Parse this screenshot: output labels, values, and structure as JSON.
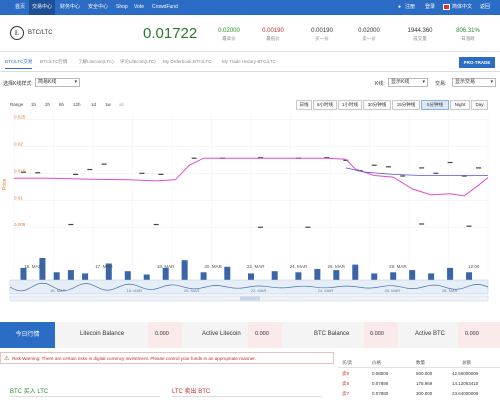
{
  "nav": {
    "items": [
      "首页",
      "交易中心",
      "财务中心",
      "安全中心",
      "Shop",
      "Vote",
      "CrowdFund"
    ],
    "active_index": 1,
    "right": [
      "注册",
      "登录",
      "简体中文",
      "返回"
    ]
  },
  "ticker": {
    "pair": "BTC/LTC",
    "last_price": "0.01722",
    "stats": [
      {
        "value": "0.02000",
        "label": "最高价",
        "color": "#2a8a2a"
      },
      {
        "value": "0.00190",
        "label": "最低价",
        "color": "#c0302a"
      },
      {
        "value": "0.00190",
        "label": "买一价",
        "color": "#333333"
      },
      {
        "value": "0.02000",
        "label": "卖一价",
        "color": "#333333"
      },
      {
        "value": "1944.360",
        "label": "成交量",
        "color": "#333333"
      },
      {
        "value": "806.31%",
        "label": "日涨跌",
        "color": "#2a8a2a"
      }
    ]
  },
  "tabs": {
    "items": [
      "BTC/LTC交易",
      "BTC/LTC行情",
      "了解Litecoin(LTC)",
      "评论Litecoin(LTC)",
      "My Orderbook-BTC/LTC",
      "My Trade History-BTC/LTC"
    ],
    "active_index": 0,
    "pro_button": "PRO-TRADE"
  },
  "toolbar": {
    "mode_label": "选择K线样式:",
    "mode_value": "简易K线",
    "kline_label": "K线:",
    "kline_value": "显示K线",
    "trades_label": "交易:",
    "trades_value": "显示交易"
  },
  "range": {
    "label": "Range",
    "buttons": [
      "1h",
      "2h",
      "6h",
      "12h",
      "1d",
      "1w",
      "all"
    ],
    "periods": [
      "日线",
      "6小时线",
      "1小时线",
      "30分钟线",
      "15分钟线",
      "5分钟线",
      "Night",
      "Day"
    ],
    "active_period_index": 5
  },
  "chart_data": {
    "type": "line",
    "y_axis_label": "Price",
    "y_ticks": [
      "0.025",
      "0.02",
      "0.015",
      "0.01",
      "0.005"
    ],
    "ylim": [
      0.003,
      0.026
    ],
    "x_labels": [
      "16. MAR",
      "17. MAR",
      "18. MAR",
      "20. MAR",
      "22. MAR",
      "24. MAR",
      "26. MAR",
      "28. MAR",
      "12:00"
    ],
    "navigator_labels": [
      "16. MAR",
      "18. MAR",
      "20. MAR",
      "22. MAR",
      "24. MAR",
      "26. MAR",
      "28. MAR"
    ],
    "ma_series": [
      [
        0,
        0.0141
      ],
      [
        0.08,
        0.0141
      ],
      [
        0.16,
        0.0139
      ],
      [
        0.24,
        0.0138
      ],
      [
        0.3,
        0.0136
      ],
      [
        0.34,
        0.0138
      ],
      [
        0.37,
        0.0165
      ],
      [
        0.4,
        0.0178
      ],
      [
        0.5,
        0.0178
      ],
      [
        0.6,
        0.0178
      ],
      [
        0.66,
        0.0178
      ],
      [
        0.7,
        0.0176
      ],
      [
        0.72,
        0.0158
      ],
      [
        0.76,
        0.0146
      ],
      [
        0.8,
        0.0143
      ],
      [
        0.84,
        0.0121
      ],
      [
        0.88,
        0.011
      ],
      [
        0.92,
        0.0112
      ],
      [
        0.95,
        0.0108
      ],
      [
        0.98,
        0.0128
      ],
      [
        1.0,
        0.0142
      ]
    ],
    "avg_series": [
      [
        0.7,
        0.016
      ],
      [
        0.74,
        0.0152
      ],
      [
        0.8,
        0.0148
      ],
      [
        0.86,
        0.0146
      ],
      [
        0.92,
        0.0146
      ],
      [
        1.0,
        0.0146
      ]
    ],
    "candles": [
      [
        0.02,
        0.0152
      ],
      [
        0.05,
        0.0151
      ],
      [
        0.13,
        0.0148
      ],
      [
        0.16,
        0.0157
      ],
      [
        0.19,
        0.0167
      ],
      [
        0.27,
        0.015
      ],
      [
        0.31,
        0.0148
      ],
      [
        0.38,
        0.0178
      ],
      [
        0.44,
        0.0178
      ],
      [
        0.52,
        0.0179
      ],
      [
        0.6,
        0.0178
      ],
      [
        0.66,
        0.0179
      ],
      [
        0.7,
        0.0174
      ],
      [
        0.73,
        0.0155
      ],
      [
        0.76,
        0.0165
      ],
      [
        0.79,
        0.0162
      ],
      [
        0.82,
        0.0145
      ],
      [
        0.86,
        0.016
      ],
      [
        0.89,
        0.015
      ],
      [
        0.92,
        0.017
      ],
      [
        0.95,
        0.0145
      ],
      [
        0.98,
        0.016
      ],
      [
        0.12,
        0.0055
      ],
      [
        0.3,
        0.0055
      ],
      [
        0.52,
        0.005
      ],
      [
        0.62,
        0.005
      ],
      [
        0.86,
        0.0056
      ],
      [
        0.96,
        0.0052
      ]
    ],
    "volumes": [
      [
        0.02,
        0.55
      ],
      [
        0.06,
        1.0
      ],
      [
        0.09,
        0.35
      ],
      [
        0.12,
        0.45
      ],
      [
        0.15,
        0.3
      ],
      [
        0.2,
        0.75
      ],
      [
        0.24,
        0.4
      ],
      [
        0.28,
        0.25
      ],
      [
        0.32,
        0.55
      ],
      [
        0.36,
        0.9
      ],
      [
        0.4,
        0.35
      ],
      [
        0.45,
        0.6
      ],
      [
        0.5,
        0.3
      ],
      [
        0.55,
        0.4
      ],
      [
        0.6,
        0.35
      ],
      [
        0.64,
        0.5
      ],
      [
        0.68,
        0.45
      ],
      [
        0.72,
        0.7
      ],
      [
        0.76,
        0.3
      ],
      [
        0.8,
        0.35
      ],
      [
        0.84,
        0.45
      ],
      [
        0.88,
        0.3
      ],
      [
        0.92,
        0.55
      ],
      [
        0.96,
        0.35
      ]
    ]
  },
  "summary": {
    "tab_label": "今日行情",
    "items": [
      {
        "label": "Litecoin Balance",
        "value": "0.000"
      },
      {
        "label": "Active Litecoin",
        "value": "0.000"
      },
      {
        "label": "BTC Balance",
        "value": "0.000"
      },
      {
        "label": "Active BTC",
        "value": "0.000"
      }
    ]
  },
  "warning": {
    "text": "Risk Warning: There are certain risks in digital currency investment. Please control your funds in an appropriate manner."
  },
  "buy_title": "BTC 买入 LTC",
  "sell_title": "LTC 卖出 BTC",
  "orderbook": {
    "headers": [
      "买/卖",
      "价格",
      "数量",
      "总额"
    ],
    "rows": [
      [
        "卖9",
        "0.08500",
        "500.000",
        "42.50000000"
      ],
      [
        "卖8",
        "0.07890",
        "178.969",
        "14.12063410"
      ],
      [
        "卖7",
        "0.07880",
        "300.000",
        "23.64000000"
      ]
    ]
  },
  "colors": {
    "nav_bg": "#2b6cc4",
    "accent": "#2b6cc4",
    "ma_line": "#e44ad6",
    "avg_line": "#5555cc",
    "sell_red": "#c0302a",
    "buy_green": "#2a8a2a"
  }
}
